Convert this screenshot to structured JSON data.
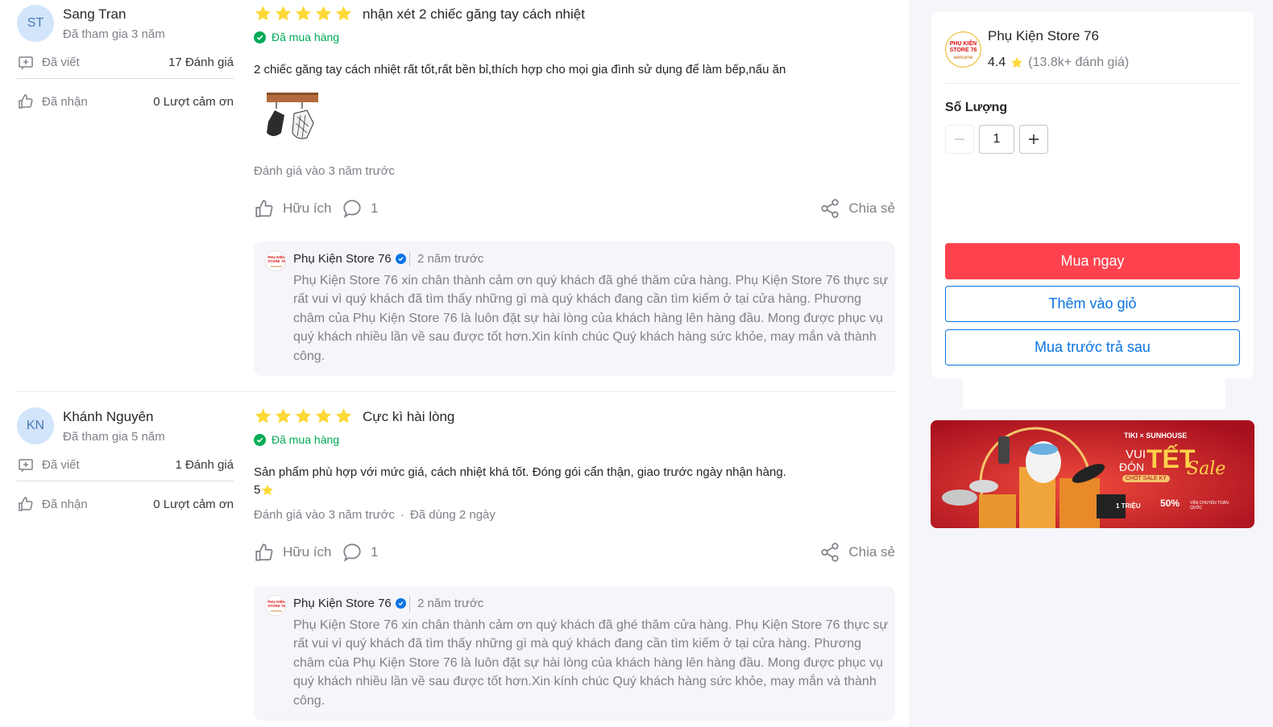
{
  "reviews": [
    {
      "avatar_initials": "ST",
      "user_name": "Sang Tran",
      "joined": "Đã tham gia 3 năm",
      "written_label": "Đã viết",
      "written_value": "17 Đánh giá",
      "received_label": "Đã nhận",
      "received_value": "0 Lượt cảm ơn",
      "rating": 5,
      "title": "nhận xét 2 chiếc găng tay cách nhiệt",
      "bought_label": "Đã mua hàng",
      "text_lines": [
        "2 chiếc găng tay cách nhiệt rất tốt,rất bền bỉ,thích hợp cho mọi gia đình sử dụng để làm bếp,nấu ăn"
      ],
      "meta": "Đánh giá vào 3 năm trước",
      "helpful_label": "Hữu ích",
      "comment_count": "1",
      "share_label": "Chia sẻ",
      "reply": {
        "name": "Phụ Kiện Store 76",
        "time": "2 năm trước",
        "body": "Phụ Kiện Store 76 xin chân thành cảm ơn quý khách đã ghé thăm cửa hàng. Phụ Kiện Store 76 thực sự rất vui vì quý khách đã tìm thấy những gì mà quý khách đang cần tìm kiếm ở tại cửa hàng. Phương châm của Phụ Kiện Store 76 là luôn đặt sự hài lòng của khách hàng lên hàng đầu. Mong được phục vụ quý khách nhiều lần về sau được tốt hơn.Xin kính chúc Quý khách hàng sức khỏe, may mắn và thành công."
      }
    },
    {
      "avatar_initials": "KN",
      "user_name": "Khánh Nguyên",
      "joined": "Đã tham gia 5 năm",
      "written_label": "Đã viết",
      "written_value": "1 Đánh giá",
      "received_label": "Đã nhận",
      "received_value": "0 Lượt cảm ơn",
      "rating": 5,
      "title": "Cực kì hài lòng",
      "bought_label": "Đã mua hàng",
      "text_lines": [
        "Sản phẩm phù hợp với mức giá, cách nhiệt khá tốt. Đóng gói cẩn thận, giao trước ngày nhận hàng.",
        "5"
      ],
      "meta": "Đánh giá vào 3 năm trước",
      "meta_extra": "Đã dùng 2 ngày",
      "meta_dot": "·",
      "helpful_label": "Hữu ích",
      "comment_count": "1",
      "share_label": "Chia sẻ",
      "reply": {
        "name": "Phụ Kiện Store 76",
        "time": "2 năm trước",
        "body": "Phụ Kiện Store 76 xin chân thành cảm ơn quý khách đã ghé thăm cửa hàng. Phụ Kiện Store 76 thực sự rất vui vì quý khách đã tìm thấy những gì mà quý khách đang cần tìm kiếm ở tại cửa hàng. Phương châm của Phụ Kiện Store 76 là luôn đặt sự hài lòng của khách hàng lên hàng đầu. Mong được phục vụ quý khách nhiều lần về sau được tốt hơn.Xin kính chúc Quý khách hàng sức khỏe, may mắn và thành công."
      }
    }
  ],
  "seller": {
    "name": "Phụ Kiện Store 76",
    "rating": "4.4",
    "rating_count": "(13.8k+ đánh giá)",
    "logo_text": [
      "PHỤ KIỆN",
      "STORE 76",
      "welcome"
    ]
  },
  "purchase": {
    "qty_label": "Số Lượng",
    "qty_value": "1",
    "buy_now": "Mua ngay",
    "add_to_cart": "Thêm vào giỏ",
    "buy_later": "Mua trước trả sau"
  },
  "banner": {
    "brand": "TIKI × SUNHOUSE",
    "line1": "VUI",
    "line2": "ĐÓN",
    "tet": "TẾT",
    "sale": "Sale",
    "sub": "CHỐT SALE KỸ",
    "promo1": "1 TRIỆU",
    "promo2": "50%",
    "promo3": "VẬN CHUYỂN TOÀN QUỐC"
  },
  "colors": {
    "star": "#fdd836",
    "bought_green": "#00ab56",
    "buy_red": "#ff424e",
    "tiki_blue": "#0b74e5"
  }
}
